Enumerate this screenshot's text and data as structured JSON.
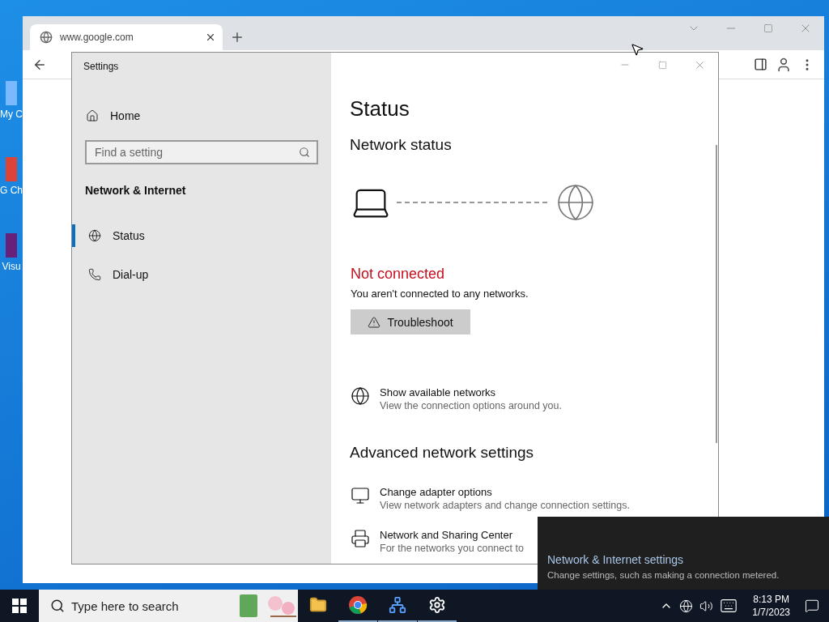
{
  "desktop_icons": [
    {
      "label": "My C"
    },
    {
      "label": "G Ch"
    },
    {
      "label": "Visu"
    }
  ],
  "browser": {
    "tab": {
      "title": "www.google.com"
    }
  },
  "settings": {
    "window": {
      "title": "Settings"
    },
    "nav": {
      "home": "Home",
      "search": {
        "placeholder": "Find a setting"
      },
      "section": "Network & Internet",
      "items": [
        {
          "label": "Status",
          "selected": true
        },
        {
          "label": "Dial-up",
          "selected": false
        }
      ]
    },
    "content": {
      "title": "Status",
      "network_heading": "Network status",
      "connected": false,
      "status": "Not connected",
      "status_detail": "You aren't connected to any networks.",
      "button": "Troubleshoot",
      "links": [
        {
          "title": "Show available networks",
          "description": "View the connection options around you."
        }
      ],
      "advanced_heading": "Advanced network settings",
      "advanced_links": [
        {
          "title": "Change adapter options",
          "description": "View network adapters and change connection settings."
        },
        {
          "title": "Network and Sharing Center",
          "description": "For the networks you connect to"
        }
      ]
    }
  },
  "flyout": {
    "title": "Network & Internet settings",
    "description": "Change settings, such as making a connection metered."
  },
  "taskbar": {
    "search": {
      "placeholder": "Type here to search"
    },
    "apps": [
      {
        "running": false
      },
      {
        "running": true
      },
      {
        "running": true
      },
      {
        "running": true
      }
    ],
    "time": "8:13 PM",
    "date": "1/7/2023"
  }
}
